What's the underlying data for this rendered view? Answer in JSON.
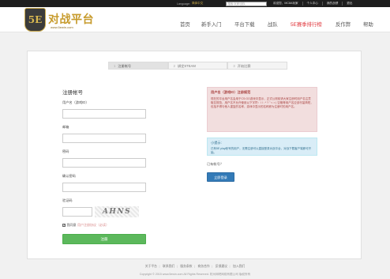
{
  "topbar": {
    "language_label": "Language:",
    "language_current": "简体中文",
    "search_placeholder": "搜索:玩家/战队",
    "links": [
      "欢迎您，MC8A玩家",
      "个人中心",
      "我的战绩",
      "退出"
    ]
  },
  "header": {
    "logo_emblem": "5E",
    "logo_text": "对战平台",
    "logo_url": "www.5ewin.com",
    "nav": [
      "首页",
      "新手入门",
      "平台下载",
      "战队",
      "5E赛季排行榜",
      "反作弊",
      "帮助"
    ],
    "nav_highlight_color": "#e0343a"
  },
  "steps": [
    {
      "num": "1",
      "label": "注册帐号",
      "active": true
    },
    {
      "num": "2",
      "label": "绑定STEAM",
      "active": false
    },
    {
      "num": "3",
      "label": "开始比赛",
      "active": false
    }
  ],
  "form": {
    "title": "注册帐号",
    "username_label": "用户名（游戏ID）",
    "email_label": "邮箱",
    "password_label": "密码",
    "confirm_password_label": "确认密码",
    "captcha_label": "验证码",
    "captcha_text": "AHNS",
    "agree_text": "我同意",
    "agree_link": "用户注册协议（必读）",
    "agree_checked": "✔",
    "submit_label": "注册"
  },
  "notices": {
    "red_title": "用户名（游戏ID）注册规范",
    "red_body": "现在的平台用户名会用于CS:GO游戏中显示，正式公测前请大家注册时用户名注意取名规范，用户名不允许使用以下字符：\\ / : * ? \" < > | 空格等用户名应该尽量简短，包括不得与他人重复的名称，游戏中显示的名称即为注册时的用户名。",
    "blue_title": "小提示:",
    "blue_body": "已有5E play帐号的用户，无需注册可以直接登录对战平台，对战下载客户端即可开始。"
  },
  "login": {
    "have_account": "已有帐号？",
    "login_button": "立即登录"
  },
  "footer": {
    "links": [
      "关于平台",
      "联系我们",
      "服务条款",
      "商务合作",
      "反馈建议",
      "加入我们"
    ],
    "copyright": "Copyright © 2015 www.5ewin.com All Rights Reserved. 杭州网吧网络有限公司 版权所有"
  }
}
